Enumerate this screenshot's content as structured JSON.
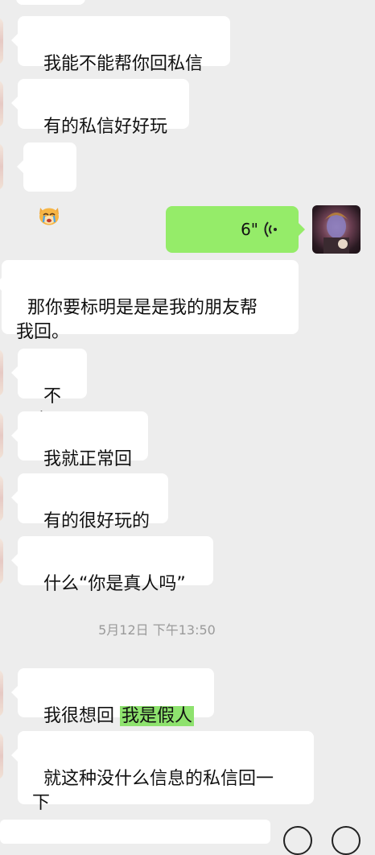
{
  "messages": [
    {
      "side": "left",
      "text": "我能不能帮你回私信"
    },
    {
      "side": "left",
      "text": "有的私信好好玩"
    },
    {
      "side": "left",
      "type": "emoji",
      "emoji": "crying-cat-emoji"
    },
    {
      "side": "right",
      "type": "voice",
      "duration": "6\""
    },
    {
      "side": "left",
      "text": "那你要标明是是是我的朋友帮\n我回。"
    },
    {
      "side": "left",
      "text": "不会"
    },
    {
      "side": "left",
      "text": "我就正常回"
    },
    {
      "side": "left",
      "text": "有的很好玩的"
    },
    {
      "side": "left",
      "text": "什么“你是真人吗”"
    },
    {
      "side": "left",
      "text_prefix": "我很想回 ",
      "text_highlight": "我是假人"
    },
    {
      "side": "left",
      "text": "就这种没什么信息的私信回一\n下"
    }
  ],
  "timestamp": "5月12日 下午13:50",
  "colors": {
    "background": "#ededed",
    "sent_bubble": "#95ec69",
    "received_bubble": "#ffffff",
    "highlight": "#8ee26e"
  },
  "icons": {
    "voice": "voice-wave-icon",
    "emoji": "emoji-icon",
    "add": "plus-icon"
  }
}
